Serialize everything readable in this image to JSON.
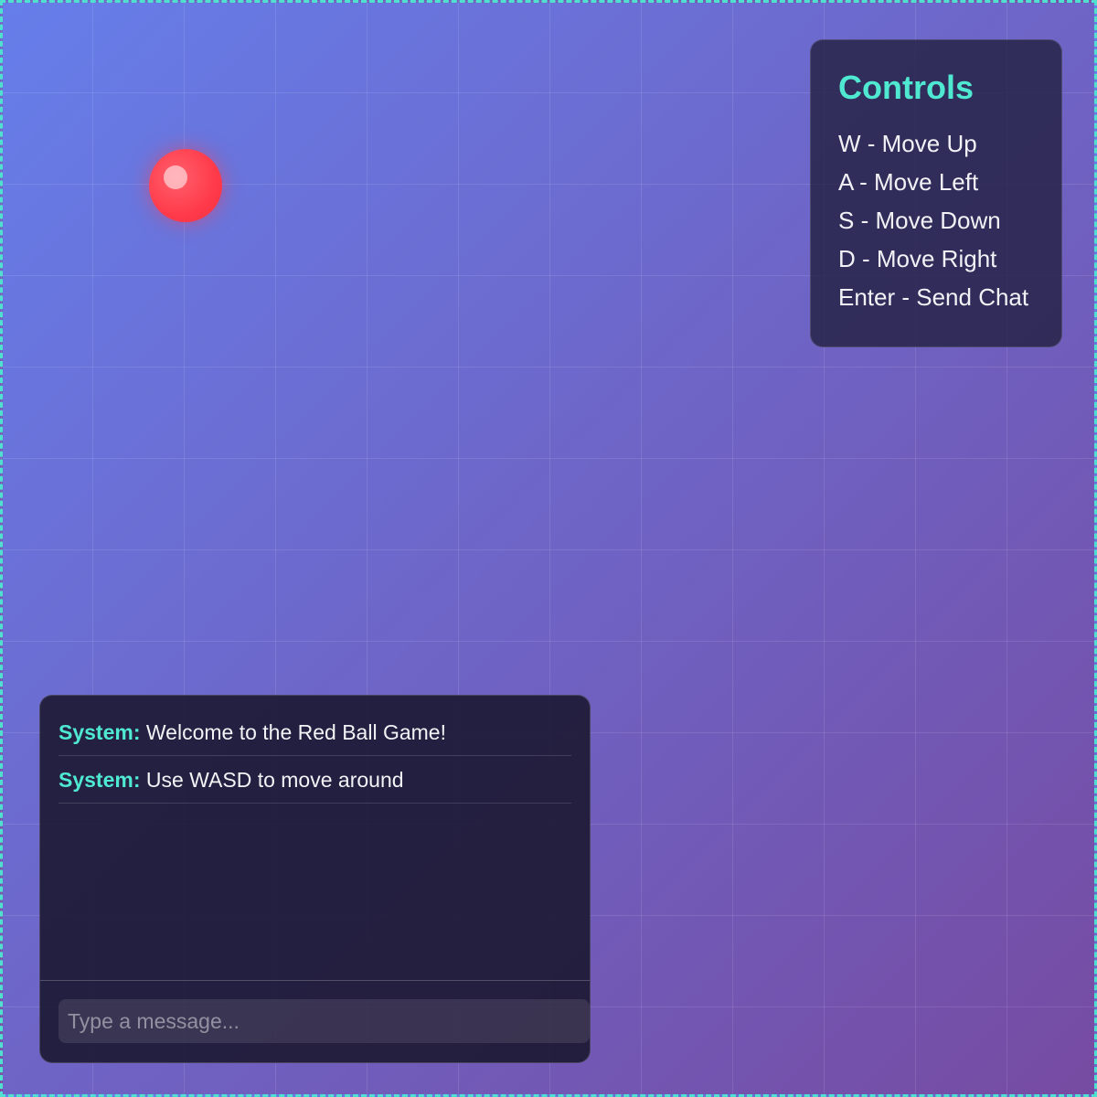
{
  "game": {
    "player": "red-ball"
  },
  "controls": {
    "title": "Controls",
    "items": [
      "W - Move Up",
      "A - Move Left",
      "S - Move Down",
      "D - Move Right",
      "Enter - Send Chat"
    ]
  },
  "chat": {
    "messages": [
      {
        "sender": "System:",
        "text": " Welcome to the Red Ball Game!"
      },
      {
        "sender": "System:",
        "text": " Use WASD to move around"
      }
    ],
    "input": {
      "placeholder": "Type a message...",
      "value": ""
    }
  },
  "colors": {
    "accent": "#4fe8d0",
    "ball": "#ff3b4a",
    "background_start": "#667eea",
    "background_end": "#764ba2"
  }
}
